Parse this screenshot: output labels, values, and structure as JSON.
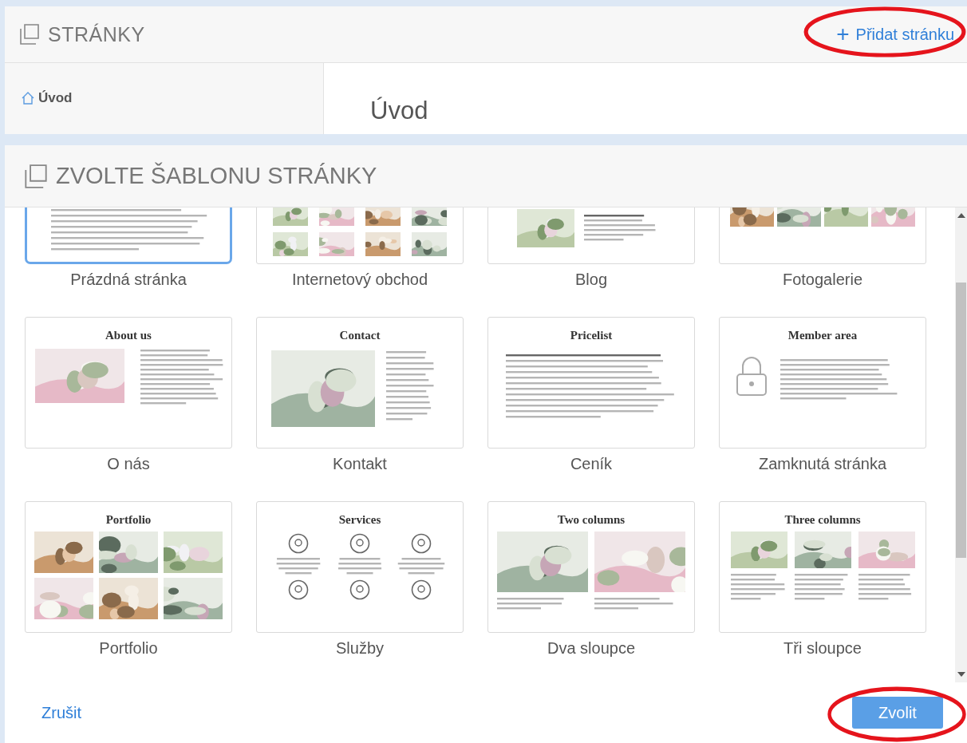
{
  "pages_panel": {
    "title": "STRÁNKY",
    "add_button": {
      "icon": "+",
      "label": "Přidat stránku",
      "highlighted": true
    },
    "pages": [
      {
        "label": "Úvod"
      }
    ],
    "page_title": "Úvod"
  },
  "dialog": {
    "title": "ZVOLTE ŠABLONU STRÁNKY",
    "templates": [
      {
        "name": "Prázdná stránka",
        "kind": "blank",
        "selected": true
      },
      {
        "name": "Internetový obchod",
        "kind": "shop",
        "selected": false
      },
      {
        "name": "Blog",
        "kind": "blog",
        "selected": false
      },
      {
        "name": "Fotogalerie",
        "kind": "gallery",
        "selected": false
      },
      {
        "name": "O nás",
        "kind": "about",
        "heading": "About us",
        "selected": false
      },
      {
        "name": "Kontakt",
        "kind": "contact",
        "heading": "Contact",
        "selected": false
      },
      {
        "name": "Ceník",
        "kind": "pricelist",
        "heading": "Pricelist",
        "selected": false
      },
      {
        "name": "Zamknutá stránka",
        "kind": "locked",
        "heading": "Member area",
        "selected": false
      },
      {
        "name": "Portfolio",
        "kind": "portfolio",
        "heading": "Portfolio",
        "selected": false
      },
      {
        "name": "Služby",
        "kind": "services",
        "heading": "Services",
        "selected": false
      },
      {
        "name": "Dva sloupce",
        "kind": "two-columns",
        "heading": "Two columns",
        "selected": false
      },
      {
        "name": "Tři sloupce",
        "kind": "three-columns",
        "heading": "Three columns",
        "selected": false
      }
    ],
    "cancel": "Zrušit",
    "confirm": {
      "label": "Zvolit",
      "highlighted": true
    }
  }
}
